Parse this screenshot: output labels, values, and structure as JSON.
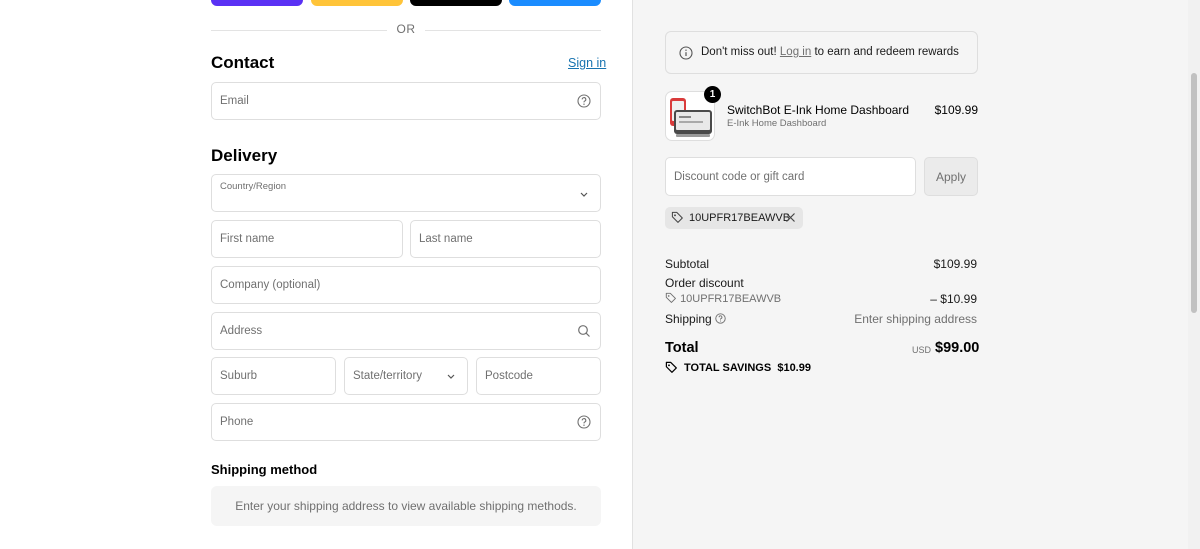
{
  "express_buttons": [
    {
      "name": "shop-pay-button",
      "color": "#5a31f4"
    },
    {
      "name": "paypal-button",
      "color": "#ffc439"
    },
    {
      "name": "apple-pay-button",
      "color": "#000000"
    },
    {
      "name": "google-pay-button",
      "color": "#1a8cff"
    }
  ],
  "divider": {
    "label": "OR"
  },
  "contact": {
    "heading": "Contact",
    "sign_in": "Sign in",
    "email_placeholder": "Email"
  },
  "delivery": {
    "heading": "Delivery",
    "country_label": "Country/Region",
    "first_name": "First name",
    "last_name": "Last name",
    "company": "Company (optional)",
    "address": "Address",
    "suburb": "Suburb",
    "state": "State/territory",
    "postcode": "Postcode",
    "phone": "Phone"
  },
  "shipping_method": {
    "heading": "Shipping method",
    "message": "Enter your shipping address to view available shipping methods."
  },
  "summary": {
    "notice_prefix": "Don't miss out!",
    "notice_link": "Log in",
    "notice_suffix": "to earn and redeem rewards",
    "product": {
      "name": "SwitchBot E-Ink Home Dashboard",
      "variant": "E-Ink Home Dashboard",
      "price": "$109.99",
      "quantity": "1"
    },
    "discount_placeholder": "Discount code or gift card",
    "apply_label": "Apply",
    "applied_code": "10UPFR17BEAWVB",
    "subtotal_label": "Subtotal",
    "subtotal_value": "$109.99",
    "order_discount_label": "Order discount",
    "order_discount_code": "10UPFR17BEAWVB",
    "order_discount_value": "– $10.99",
    "shipping_label": "Shipping",
    "shipping_value": "Enter shipping address",
    "total_label": "Total",
    "currency": "USD",
    "total_value": "$99.00",
    "savings_label": "TOTAL SAVINGS",
    "savings_value": "$10.99"
  },
  "colors": {
    "link": "#1773b0",
    "muted": "#707070",
    "border": "#dedede",
    "summary_bg": "#f5f5f5"
  }
}
